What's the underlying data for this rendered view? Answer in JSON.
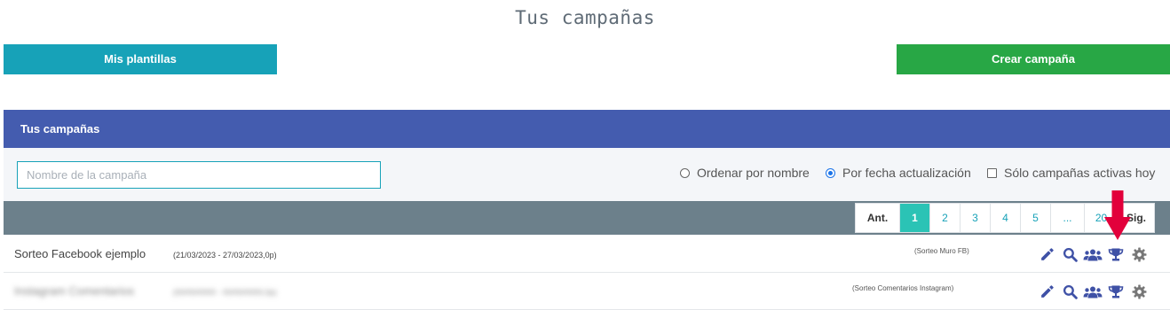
{
  "page": {
    "title": "Tus campañas"
  },
  "toolbar": {
    "templates_label": "Mis plantillas",
    "create_label": "Crear campaña"
  },
  "panel": {
    "header": "Tus campañas"
  },
  "filters": {
    "search_placeholder": "Nombre de la campaña",
    "search_value": "",
    "sort_by_name": "Ordenar por nombre",
    "sort_by_date": "Por fecha actualización",
    "sort_selected": "date",
    "active_only": "Sólo campañas activas hoy",
    "active_only_checked": false
  },
  "pagination": {
    "prev": "Ant.",
    "pages": [
      "1",
      "2",
      "3",
      "4",
      "5",
      "...",
      "20"
    ],
    "current": "1",
    "next": "Sig."
  },
  "campaigns": [
    {
      "name": "Sorteo Facebook ejemplo",
      "dates": "(21/03/2023 - 27/03/2023,0p)",
      "type": "(Sorteo Muro FB)",
      "blurred": false
    },
    {
      "name": "Instagram Comentarios",
      "dates": "(00/00/0000 - 00/00/0000,0p)",
      "type": "(Sorteo Comentarios Instagram)",
      "blurred": true
    }
  ],
  "action_icons": [
    "pencil-icon",
    "magnifier-icon",
    "users-icon",
    "trophy-icon",
    "gear-icon"
  ],
  "colors": {
    "templates_button": "#17a2b8",
    "create_button": "#28a745",
    "panel_header": "#445caf",
    "pager_bar": "#6c808b",
    "active_page": "#2bc3b5",
    "action_icon": "#3f51a6",
    "gear_icon": "#777777",
    "highlight_arrow": "#e2003b"
  }
}
